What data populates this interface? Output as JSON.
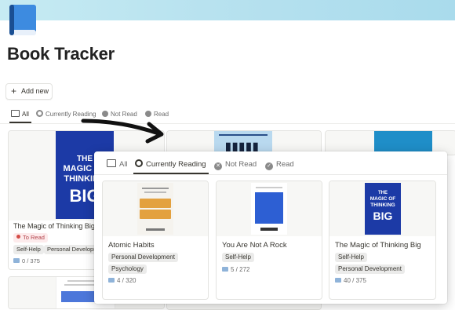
{
  "app": {
    "title": "Book Tracker",
    "add_button": "Add new"
  },
  "tabs": [
    "All",
    "Currently Reading",
    "Not Read",
    "Read"
  ],
  "background_cards": [
    {
      "title": "The Magic of Thinking Big",
      "status": "To Read",
      "tags": [
        "Self-Help",
        "Personal Development"
      ],
      "progress": "0 / 375"
    }
  ],
  "overlay": {
    "tabs": [
      "All",
      "Currently Reading",
      "Not Read",
      "Read"
    ],
    "active_tab": "Currently Reading",
    "cards": [
      {
        "title": "Atomic Habits",
        "tags": [
          "Personal Development",
          "Psychology"
        ],
        "progress": "4 / 320"
      },
      {
        "title": "You Are Not A Rock",
        "tags": [
          "Self-Help"
        ],
        "progress": "5 / 272"
      },
      {
        "title": "The Magic of Thinking Big",
        "tags": [
          "Self-Help",
          "Personal Development"
        ],
        "progress": "40 / 375"
      }
    ]
  },
  "icons": {
    "page_icon": "blue-book-icon",
    "view": "table-view-icon",
    "currently_reading": "circle-icon",
    "not_read": "x-circle-icon",
    "read": "check-circle-icon",
    "progress": "open-book-icon"
  },
  "colors": {
    "banner": "#b8e2ef",
    "book_icon": "#2e7fd6",
    "status_red": "#d44c47"
  }
}
